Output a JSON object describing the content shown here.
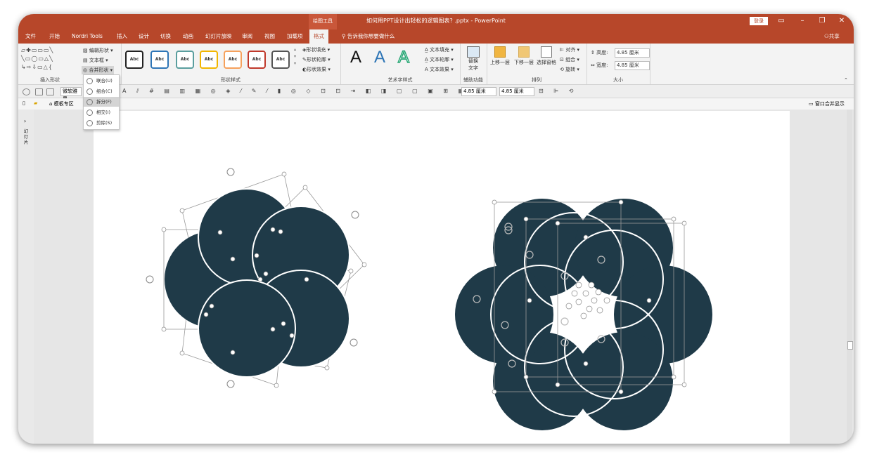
{
  "window": {
    "drawing_tools": "绘图工具",
    "title": "如何用PPT设计出轻松的逻辑图表? .pptx - PowerPoint",
    "login": "登录"
  },
  "menu": {
    "tabs": [
      "文件",
      "开始",
      "Nordri Tools",
      "插入",
      "设计",
      "切换",
      "动画",
      "幻灯片放映",
      "审阅",
      "视图",
      "加载项"
    ],
    "active_tab": "格式",
    "tell_me": "告诉我你想要做什么",
    "share": "共享"
  },
  "ribbon": {
    "insert_shapes": {
      "edit_shape": "编辑形状",
      "text_box": "文本框",
      "merge_shapes": "合并形状",
      "label": "插入形状"
    },
    "shape_styles": {
      "swatch_text": "Abc",
      "fill": "形状填充",
      "outline": "形状轮廓",
      "effects": "形状效果",
      "label": "形状样式"
    },
    "wordart": {
      "letter": "A",
      "text_fill": "文本填充",
      "text_outline": "文本轮廓",
      "text_effects": "文本效果",
      "label": "艺术字样式"
    },
    "accessibility": {
      "alt_text_line1": "替换",
      "alt_text_line2": "文字",
      "label": "辅助功能"
    },
    "arrange": {
      "bring_forward": "上移一层",
      "send_backward": "下移一层",
      "selection_pane": "选择窗格",
      "align": "对齐",
      "group": "组合",
      "rotate": "旋转",
      "label": "排列"
    },
    "size": {
      "height_label": "高度:",
      "height_value": "4.85 厘米",
      "width_label": "宽度:",
      "width_value": "4.85 厘米",
      "label": "大小"
    }
  },
  "merge_menu": {
    "items": [
      {
        "label": "联合(U)",
        "selected": false
      },
      {
        "label": "组合(C)",
        "selected": false
      },
      {
        "label": "拆分(F)",
        "selected": true
      },
      {
        "label": "相交(I)",
        "selected": false
      },
      {
        "label": "剪除(S)",
        "selected": false
      }
    ]
  },
  "toolbar2": {
    "font_name": "微软雅黑",
    "size1": "4.85 厘米",
    "size2": "4.85 厘米"
  },
  "toolbar3": {
    "template_zone": "模板专区",
    "merge_display": "窗口合并显示"
  },
  "left_pane": {
    "label": "幻灯片"
  },
  "colors": {
    "accent": "#b7472a",
    "circle_fill": "#1f3a48",
    "circle_stroke": "#ffffff"
  }
}
